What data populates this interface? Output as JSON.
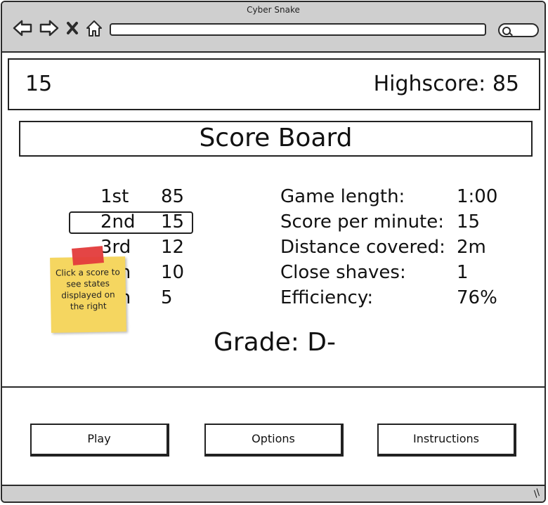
{
  "window": {
    "title": "Cyber Snake"
  },
  "header": {
    "current_score": "15",
    "highscore": "Highscore: 85"
  },
  "board": {
    "title": "Score Board",
    "ranks": [
      {
        "place": "1st",
        "score": "85"
      },
      {
        "place": "2nd",
        "score": "15"
      },
      {
        "place": "3rd",
        "score": "12"
      },
      {
        "place": "4th",
        "score": "10"
      },
      {
        "place": "5th",
        "score": "5"
      }
    ],
    "stats": [
      {
        "label": "Game length:",
        "value": "1:00"
      },
      {
        "label": "Score per minute:",
        "value": "15"
      },
      {
        "label": "Distance covered:",
        "value": "2m"
      },
      {
        "label": "Close shaves:",
        "value": "1"
      },
      {
        "label": "Efficiency:",
        "value": "76%"
      }
    ],
    "grade": "Grade: D-"
  },
  "sticky_note": {
    "text": "Click a score to see states displayed on the right"
  },
  "buttons": {
    "play": "Play",
    "options": "Options",
    "instructions": "Instructions"
  },
  "colors": {
    "chrome": "#cfcfcf",
    "note": "#f5d660",
    "tape": "#e33b3b"
  },
  "icons": [
    "back-icon",
    "forward-icon",
    "close-icon",
    "home-icon",
    "search-icon",
    "resize-grip-icon"
  ]
}
